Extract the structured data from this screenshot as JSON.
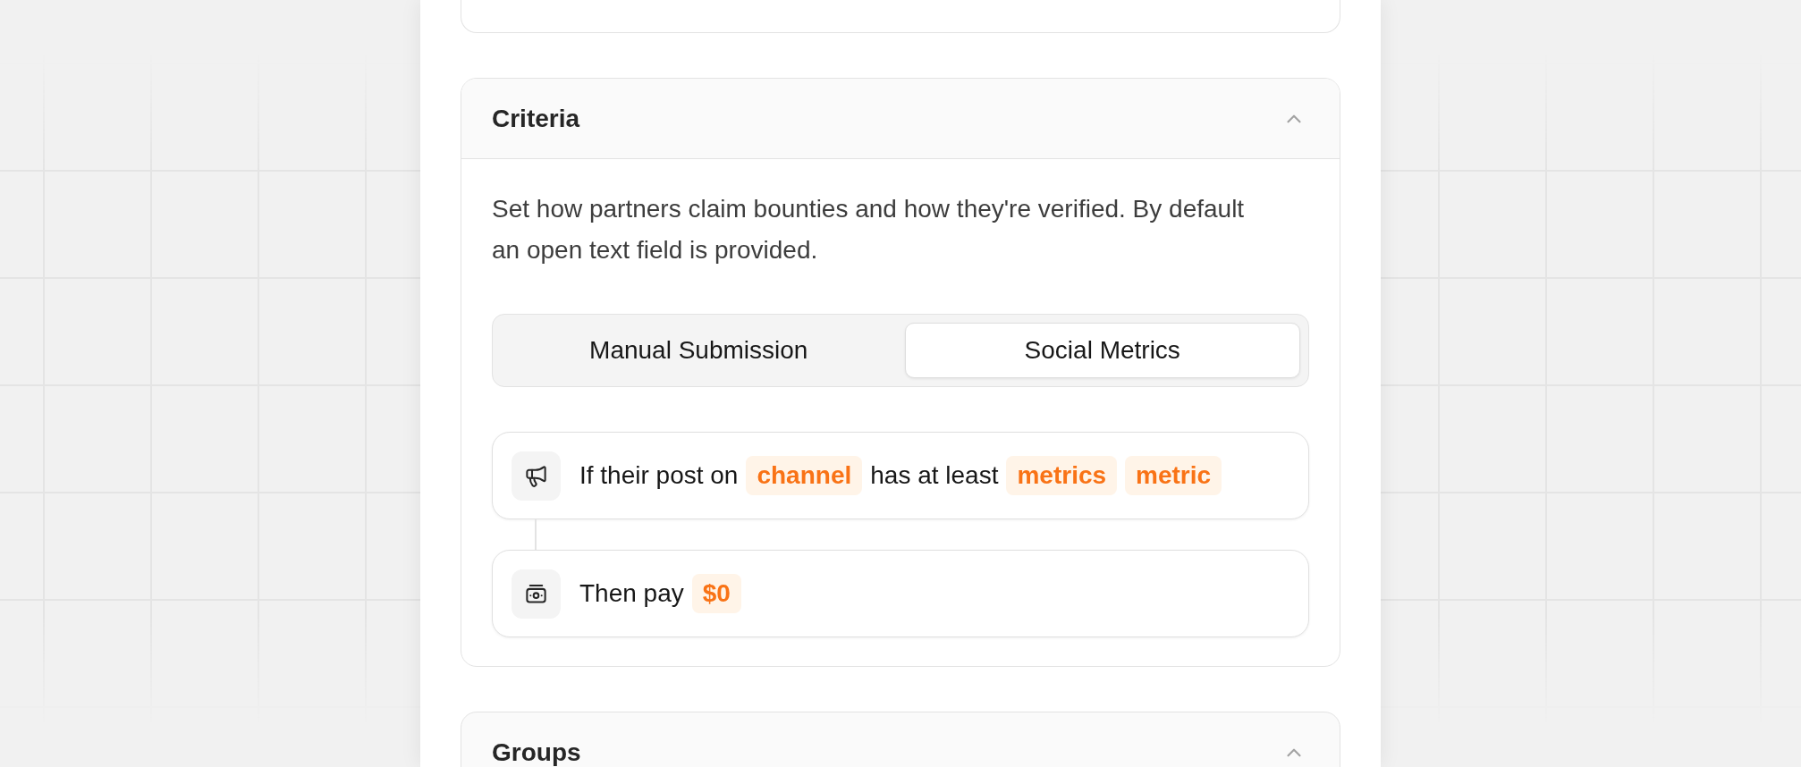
{
  "sections": [
    {
      "title": "Criteria",
      "expanded": true,
      "description": "Set how partners claim bounties and how they're verified. By default an open text field is provided.",
      "mode_tabs": [
        {
          "label": "Manual Submission",
          "selected": false
        },
        {
          "label": "Social Metrics",
          "selected": true
        }
      ],
      "rules": [
        {
          "kind": "condition",
          "parts": [
            {
              "kind": "text",
              "text": "If their post on"
            },
            {
              "kind": "token",
              "text": "channel"
            },
            {
              "kind": "text",
              "text": "has at least"
            },
            {
              "kind": "token",
              "text": "metrics"
            },
            {
              "kind": "token",
              "text": "metric"
            }
          ]
        },
        {
          "kind": "payout",
          "parts": [
            {
              "kind": "text",
              "text": "Then pay"
            },
            {
              "kind": "token",
              "text": "$0"
            }
          ]
        }
      ]
    },
    {
      "title": "Groups",
      "expanded": true
    }
  ]
}
